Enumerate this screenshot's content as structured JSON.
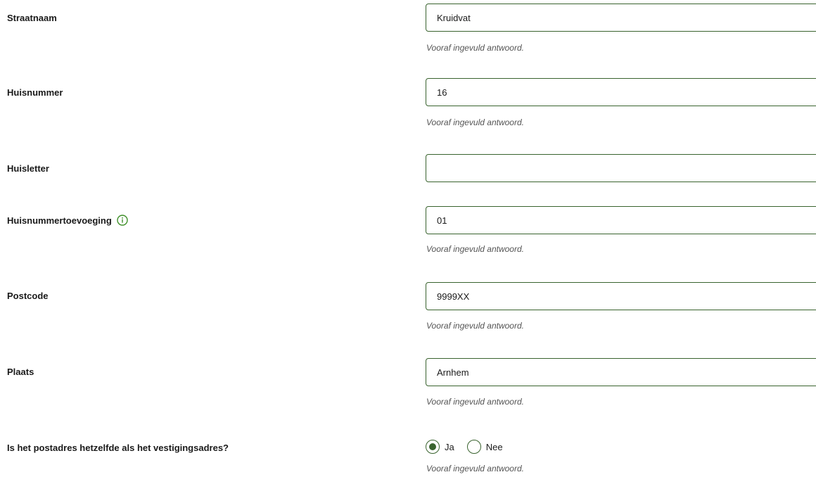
{
  "accent_color": "#39632e",
  "fields": [
    {
      "label": "Straatnaam",
      "value": "Kruidvat",
      "hint": "Vooraf ingevuld antwoord."
    },
    {
      "label": "Huisnummer",
      "value": "16",
      "hint": "Vooraf ingevuld antwoord."
    },
    {
      "label": "Huisletter",
      "value": ""
    },
    {
      "label": "Huisnummertoevoeging",
      "value": "01",
      "hint": "Vooraf ingevuld antwoord.",
      "icon": "info-icon"
    },
    {
      "label": "Postcode",
      "value": "9999XX",
      "hint": "Vooraf ingevuld antwoord."
    },
    {
      "label": "Plaats",
      "value": "Arnhem",
      "hint": "Vooraf ingevuld antwoord."
    }
  ],
  "postadres": {
    "question": "Is het postadres hetzelfde als het vestigingsadres?",
    "options": [
      {
        "label": "Ja",
        "selected": true
      },
      {
        "label": "Nee",
        "selected": false
      }
    ],
    "hint": "Vooraf ingevuld antwoord."
  }
}
